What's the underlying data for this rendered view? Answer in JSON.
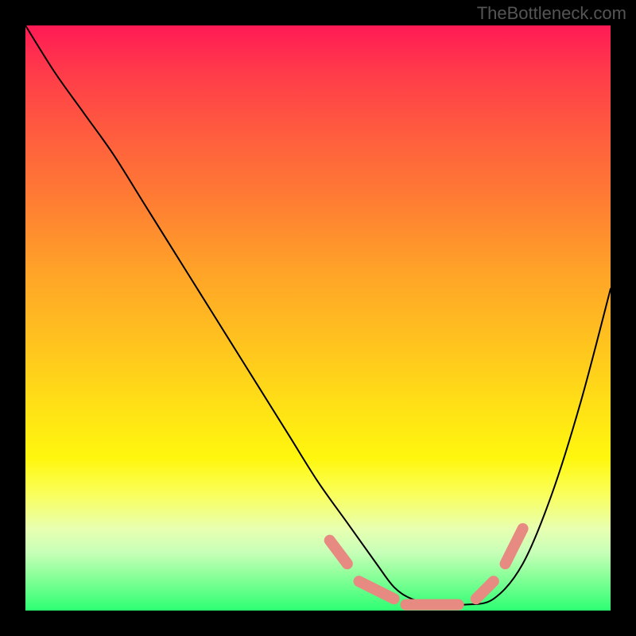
{
  "watermark": "TheBottleneck.com",
  "chart_data": {
    "type": "line",
    "title": "",
    "xlabel": "",
    "ylabel": "",
    "xlim": [
      0,
      100
    ],
    "ylim": [
      0,
      100
    ],
    "grid": false,
    "legend": false,
    "series": [
      {
        "name": "bottleneck-curve",
        "x": [
          0,
          5,
          10,
          15,
          20,
          25,
          30,
          35,
          40,
          45,
          50,
          55,
          60,
          63,
          66,
          70,
          75,
          80,
          85,
          90,
          95,
          100
        ],
        "values": [
          100,
          92,
          85,
          78,
          70,
          62,
          54,
          46,
          38,
          30,
          22,
          15,
          8,
          4,
          2,
          1,
          1,
          2,
          8,
          20,
          36,
          55
        ]
      }
    ],
    "annotations": {
      "optimal_dashes": {
        "color": "#e78a82",
        "segments": [
          {
            "x": [
              52,
              55
            ],
            "y": [
              12,
              8
            ]
          },
          {
            "x": [
              57,
              63
            ],
            "y": [
              5,
              2
            ]
          },
          {
            "x": [
              65,
              74
            ],
            "y": [
              1,
              1
            ]
          },
          {
            "x": [
              77,
              80
            ],
            "y": [
              2,
              5
            ]
          },
          {
            "x": [
              82,
              85
            ],
            "y": [
              8,
              14
            ]
          }
        ]
      }
    },
    "background_gradient_stops": [
      {
        "pos": 0.0,
        "color": "#ff1a55"
      },
      {
        "pos": 0.3,
        "color": "#ff7d33"
      },
      {
        "pos": 0.66,
        "color": "#ffe315"
      },
      {
        "pos": 0.86,
        "color": "#e8ffb0"
      },
      {
        "pos": 1.0,
        "color": "#2cff72"
      }
    ]
  }
}
